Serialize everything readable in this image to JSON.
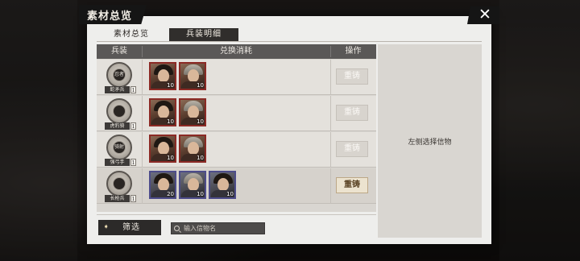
{
  "window": {
    "title": "素材总览",
    "close_glyph": "✕"
  },
  "tabs": [
    {
      "label": "素材总览",
      "active": false
    },
    {
      "label": "兵装明细",
      "active": true
    }
  ],
  "table": {
    "headers": {
      "type": "兵装",
      "cost": "兑换消耗",
      "op": "操作"
    },
    "rows": [
      {
        "unit_emblem": "忍者",
        "unit_name": "蛇矛兵",
        "unit_count": "1",
        "cards": [
          {
            "icon": "general-portrait-icon",
            "qty": "10",
            "rarity_color": "#8b2a25"
          },
          {
            "icon": "general-portrait-icon",
            "qty": "10",
            "rarity_color": "#8b2a25"
          }
        ],
        "action": {
          "label": "重铸",
          "enabled": false
        }
      },
      {
        "unit_emblem": "",
        "unit_name": "虎豹骑",
        "unit_count": "1",
        "cards": [
          {
            "icon": "general-portrait-icon",
            "qty": "10",
            "rarity_color": "#8b2a25"
          },
          {
            "icon": "general-portrait-icon",
            "qty": "10",
            "rarity_color": "#8b2a25"
          }
        ],
        "action": {
          "label": "重铸",
          "enabled": false
        }
      },
      {
        "unit_emblem": "骑射",
        "unit_name": "强弓手",
        "unit_count": "1",
        "cards": [
          {
            "icon": "general-portrait-icon",
            "qty": "10",
            "rarity_color": "#8b2a25"
          },
          {
            "icon": "general-portrait-icon",
            "qty": "10",
            "rarity_color": "#8b2a25"
          }
        ],
        "action": {
          "label": "重铸",
          "enabled": false
        }
      },
      {
        "unit_emblem": "",
        "unit_name": "长枪兵",
        "unit_count": "1",
        "cards": [
          {
            "icon": "general-portrait-icon",
            "qty": "20",
            "rarity_color": "#4d4c8a"
          },
          {
            "icon": "general-portrait-icon",
            "qty": "10",
            "rarity_color": "#4d4c8a"
          },
          {
            "icon": "general-portrait-icon",
            "qty": "10",
            "rarity_color": "#4d4c8a"
          }
        ],
        "action": {
          "label": "重铸",
          "enabled": true
        }
      }
    ]
  },
  "filter": {
    "label": "筛选",
    "arrow": "➧"
  },
  "search": {
    "placeholder": "输入信物名"
  },
  "detail": {
    "hint": "左侧选择信物"
  },
  "colors": {
    "panel_bg": "#eeeeec",
    "header_bg": "#5a5857",
    "tab_active_bg": "#302e2c",
    "button_enabled_text": "#5a4324",
    "orange_card_border": "#8b2a25",
    "blue_card_border": "#4d4c8a"
  }
}
